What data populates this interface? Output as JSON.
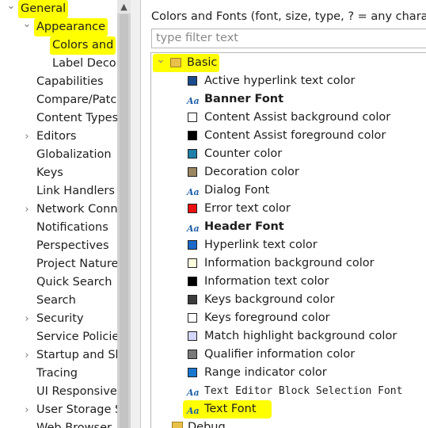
{
  "left_tree": {
    "items": [
      {
        "label": "General",
        "twisty": "v"
      },
      {
        "label": "Appearance",
        "twisty": "v"
      },
      {
        "label": "Colors and",
        "twisty": ""
      },
      {
        "label": "Label Decor",
        "twisty": ""
      },
      {
        "label": "Capabilities",
        "twisty": ""
      },
      {
        "label": "Compare/Patch",
        "twisty": ""
      },
      {
        "label": "Content Types",
        "twisty": ""
      },
      {
        "label": "Editors",
        "twisty": ">"
      },
      {
        "label": "Globalization",
        "twisty": ""
      },
      {
        "label": "Keys",
        "twisty": ""
      },
      {
        "label": "Link Handlers",
        "twisty": ""
      },
      {
        "label": "Network Conn",
        "twisty": ">"
      },
      {
        "label": "Notifications",
        "twisty": ""
      },
      {
        "label": "Perspectives",
        "twisty": ""
      },
      {
        "label": "Project Natures",
        "twisty": ""
      },
      {
        "label": "Quick Search",
        "twisty": ""
      },
      {
        "label": "Search",
        "twisty": ""
      },
      {
        "label": "Security",
        "twisty": ">"
      },
      {
        "label": "Service Policies",
        "twisty": ""
      },
      {
        "label": "Startup and Sh",
        "twisty": ">"
      },
      {
        "label": "Tracing",
        "twisty": ""
      },
      {
        "label": "UI Responsiven",
        "twisty": ""
      },
      {
        "label": "User Storage S",
        "twisty": ">"
      },
      {
        "label": "Web Browser",
        "twisty": ""
      }
    ]
  },
  "right_panel": {
    "header": "Colors and Fonts (font, size, type, ? = any character",
    "filter_placeholder": "type filter text",
    "category": {
      "label": "Basic",
      "twisty": "v"
    },
    "entries": [
      {
        "label": "Active hyperlink text color",
        "kind": "color",
        "color": "#1a4c8c"
      },
      {
        "label": "Banner Font",
        "kind": "font",
        "style": "bold"
      },
      {
        "label": "Content Assist background color",
        "kind": "color",
        "color": "#ffffff"
      },
      {
        "label": "Content Assist foreground color",
        "kind": "color",
        "color": "#000000"
      },
      {
        "label": "Counter color",
        "kind": "color",
        "color": "#1e7fa8"
      },
      {
        "label": "Decoration color",
        "kind": "color",
        "color": "#9a8660"
      },
      {
        "label": "Dialog Font",
        "kind": "font",
        "style": "normal"
      },
      {
        "label": "Error text color",
        "kind": "color",
        "color": "#ee1111"
      },
      {
        "label": "Header Font",
        "kind": "font",
        "style": "bold"
      },
      {
        "label": "Hyperlink text color",
        "kind": "color",
        "color": "#1a68c8"
      },
      {
        "label": "Information background color",
        "kind": "color",
        "color": "#ffffe0"
      },
      {
        "label": "Information text color",
        "kind": "color",
        "color": "#000000"
      },
      {
        "label": "Keys background color",
        "kind": "color",
        "color": "#3c3c3c"
      },
      {
        "label": "Keys foreground color",
        "kind": "color",
        "color": "#ffffff"
      },
      {
        "label": "Match highlight background color",
        "kind": "color",
        "color": "#d6d6ff"
      },
      {
        "label": "Qualifier information color",
        "kind": "color",
        "color": "#7a7a7a"
      },
      {
        "label": "Range indicator color",
        "kind": "color",
        "color": "#1878d0"
      },
      {
        "label": "Text Editor Block Selection Font",
        "kind": "font",
        "style": "mono"
      },
      {
        "label": "Text Font",
        "kind": "font",
        "style": "normal"
      },
      {
        "label": "Debug",
        "kind": "category",
        "style": "normal"
      }
    ],
    "icons": {
      "font": "Aa",
      "category": "folder-palette-icon"
    }
  },
  "colors": {
    "highlight": "#ffff00",
    "font_icon": "#1f5fa8"
  }
}
